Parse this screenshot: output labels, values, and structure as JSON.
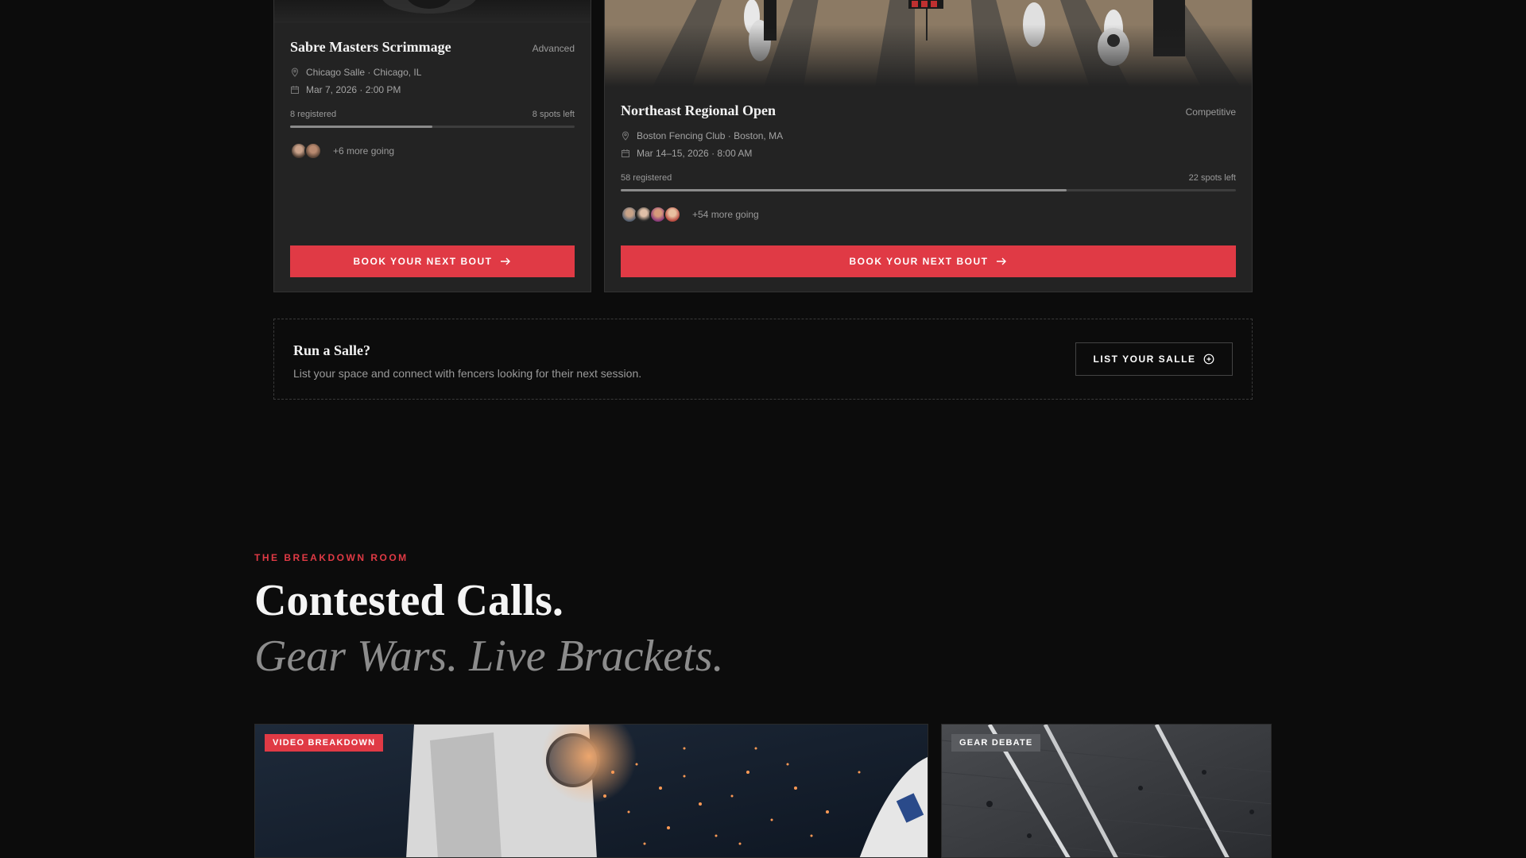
{
  "events": [
    {
      "title": "Sabre Masters Scrimmage",
      "level": "Advanced",
      "location": "Chicago Salle · Chicago, IL",
      "date": "Mar 7, 2026 · 2:00 PM",
      "registered": "8 registered",
      "spots": "8 spots left",
      "fill": 0.5,
      "going": "+6 more going",
      "cta": "BOOK YOUR NEXT BOUT"
    },
    {
      "title": "Northeast Regional Open",
      "level": "Competitive",
      "location": "Boston Fencing Club · Boston, MA",
      "date": "Mar 14–15, 2026 · 8:00 AM",
      "registered": "58 registered",
      "spots": "22 spots left",
      "fill": 0.725,
      "going": "+54 more going",
      "cta": "BOOK YOUR NEXT BOUT"
    }
  ],
  "salle": {
    "title": "Run a Salle?",
    "text": "List your space and connect with fencers looking for their next session.",
    "cta": "LIST YOUR SALLE"
  },
  "breakdown": {
    "eyebrow": "THE BREAKDOWN ROOM",
    "headline": "Contested Calls.",
    "subline": "Gear Wars. Live Brackets.",
    "tiles": [
      {
        "tag": "VIDEO BREAKDOWN"
      },
      {
        "tag": "GEAR DEBATE"
      }
    ]
  },
  "colors": {
    "accent": "#e03a45",
    "background": "#0c0c0c",
    "card": "#232323"
  },
  "icons": [
    "map-pin-icon",
    "calendar-icon",
    "arrow-right-icon",
    "plus-circle-icon"
  ]
}
